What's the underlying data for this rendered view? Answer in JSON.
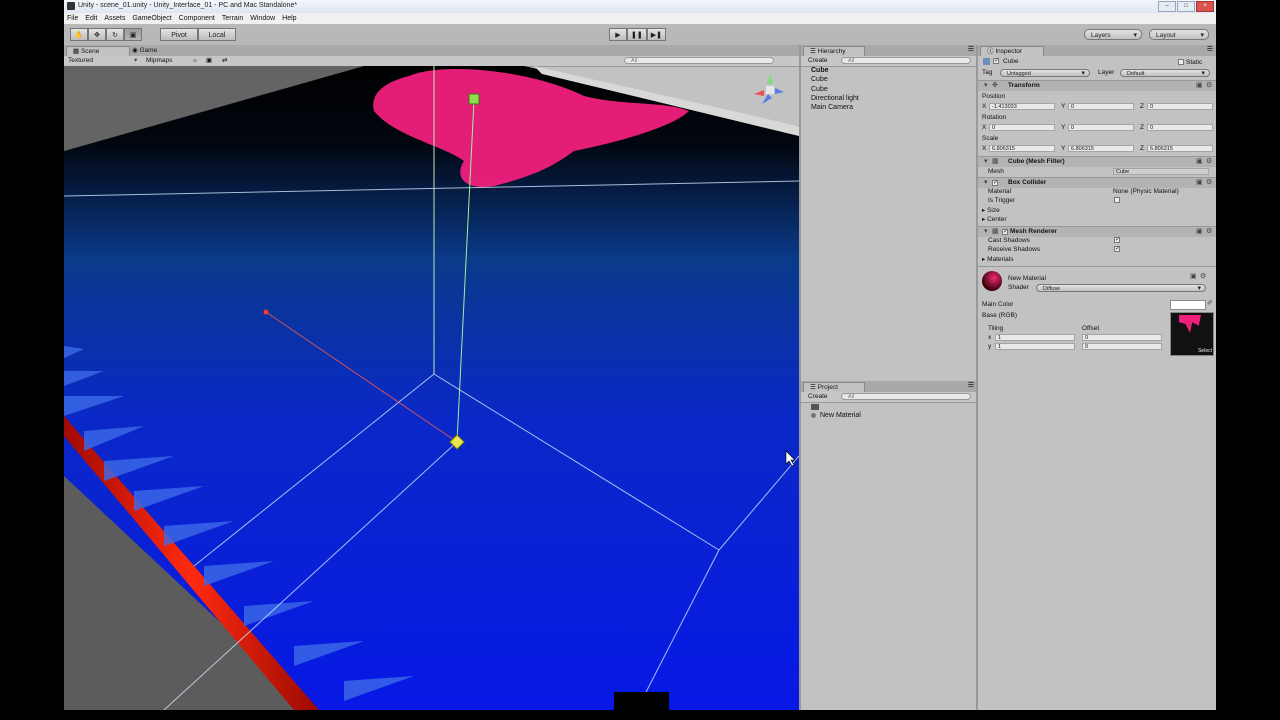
{
  "window": {
    "title": "Unity - scene_01.unity - Unity_Interface_01 - PC and Mac Standalone*"
  },
  "menu": [
    "File",
    "Edit",
    "Assets",
    "GameObject",
    "Component",
    "Terrain",
    "Window",
    "Help"
  ],
  "toolbar": {
    "tools": [
      "hand-icon",
      "move-icon",
      "rotate-icon",
      "scale-icon"
    ],
    "pivot": "Pivot",
    "local": "Local",
    "play_controls": [
      "play-icon",
      "pause-icon",
      "step-icon"
    ],
    "layers": "Layers",
    "layout": "Layout"
  },
  "scene_panel": {
    "tabs": [
      "Scene",
      "Game"
    ],
    "render_mode": "Textured",
    "mipmaps": "Mipmaps",
    "search_placeholder": "All"
  },
  "hierarchy": {
    "tab": "Hierarchy",
    "create": "Create",
    "search_placeholder": "All",
    "items": [
      "Cube",
      "Cube",
      "Cube",
      "Directional light",
      "Main Camera"
    ]
  },
  "project": {
    "tab": "Project",
    "create": "Create",
    "search_placeholder": "All",
    "items": [
      "",
      "New Material"
    ]
  },
  "inspector": {
    "tab": "Inspector",
    "object_name": "Cube",
    "static_label": "Static",
    "tag_label": "Tag",
    "tag_value": "Untagged",
    "layer_label": "Layer",
    "layer_value": "Default",
    "transform": {
      "title": "Transform",
      "position_label": "Position",
      "position": {
        "x": "-1.413033",
        "y": "0",
        "z": "0"
      },
      "rotation_label": "Rotation",
      "rotation": {
        "x": "0",
        "y": "0",
        "z": "0"
      },
      "scale_label": "Scale",
      "scale": {
        "x": "6.806315",
        "y": "6.806315",
        "z": "6.806315"
      }
    },
    "mesh_filter": {
      "title": "Cube (Mesh Filter)",
      "mesh_label": "Mesh",
      "mesh_value": "Cube"
    },
    "box_collider": {
      "title": "Box Collider",
      "material_label": "Material",
      "material_value": "None (Physic Material)",
      "trigger_label": "Is Trigger",
      "size_label": "Size",
      "center_label": "Center"
    },
    "mesh_renderer": {
      "title": "Mesh Renderer",
      "cast_label": "Cast Shadows",
      "receive_label": "Receive Shadows",
      "materials_label": "Materials"
    },
    "material": {
      "name": "New Material",
      "shader_label": "Shader",
      "shader_value": "Diffuse",
      "main_color_label": "Main Color",
      "base_label": "Base (RGB)",
      "tiling_label": "Tiling",
      "offset_label": "Offset",
      "tiling": {
        "x": "1",
        "y": "1"
      },
      "offset": {
        "x": "0",
        "y": "0"
      },
      "select_label": "Select"
    }
  },
  "colors": {
    "floor": "#0a22e8",
    "pink": "#f01f7c",
    "red_bar": "#e81a0a"
  }
}
